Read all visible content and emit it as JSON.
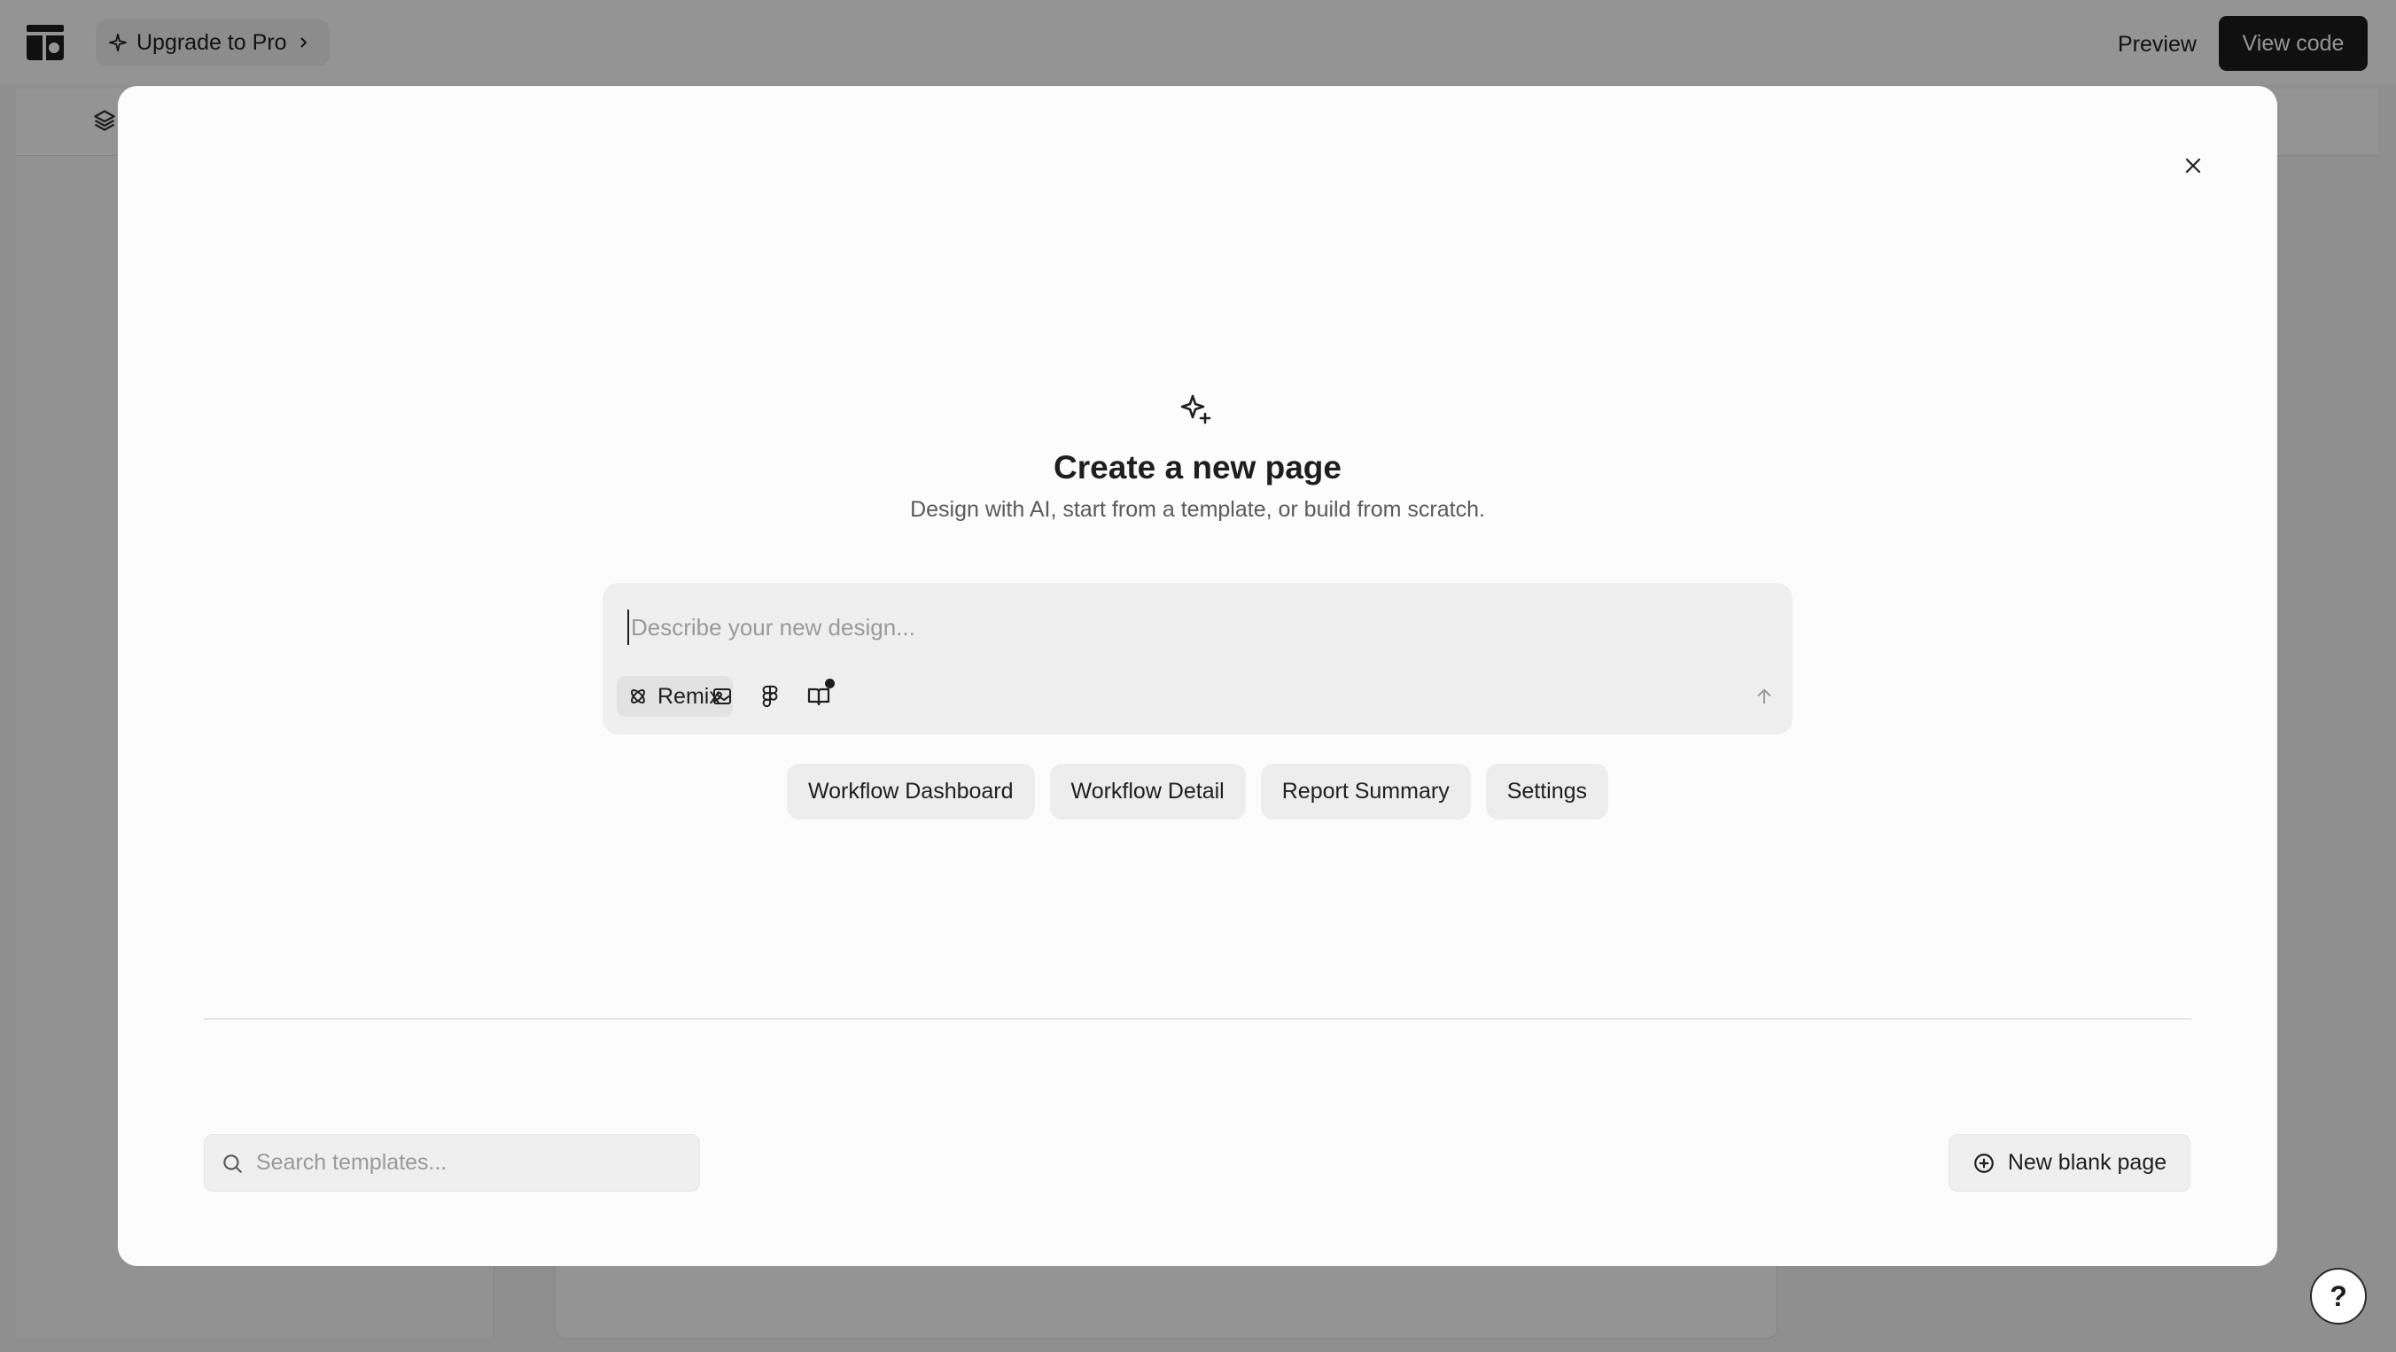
{
  "topbar": {
    "upgrade_label": "Upgrade to Pro",
    "preview_label": "Preview",
    "view_code_label": "View code"
  },
  "modal": {
    "title": "Create a new page",
    "subtitle": "Design with AI, start from a template, or build from scratch.",
    "prompt": {
      "value": "",
      "placeholder": "Describe your new design...",
      "remix_label": "Remix"
    },
    "suggestions": [
      {
        "label": "Workflow Dashboard"
      },
      {
        "label": "Workflow Detail"
      },
      {
        "label": "Report Summary"
      },
      {
        "label": "Settings"
      }
    ],
    "search": {
      "value": "",
      "placeholder": "Search templates..."
    },
    "new_blank_label": "New blank page"
  },
  "help_label": "?",
  "icons": {
    "logo": "logo-icon",
    "upgrade": "sparkle-icon",
    "close": "close-icon",
    "header": "sparkles-icon",
    "remix": "remix-icon",
    "image": "image-icon",
    "figma": "figma-icon",
    "book": "book-icon",
    "send": "arrow-up-icon",
    "search": "search-icon",
    "new_blank": "plus-circle-icon"
  },
  "colors": {
    "primary_button": "#1c1c1c",
    "overlay": "rgba(0,0,0,0.42)",
    "modal_bg": "#fcfcfc"
  }
}
